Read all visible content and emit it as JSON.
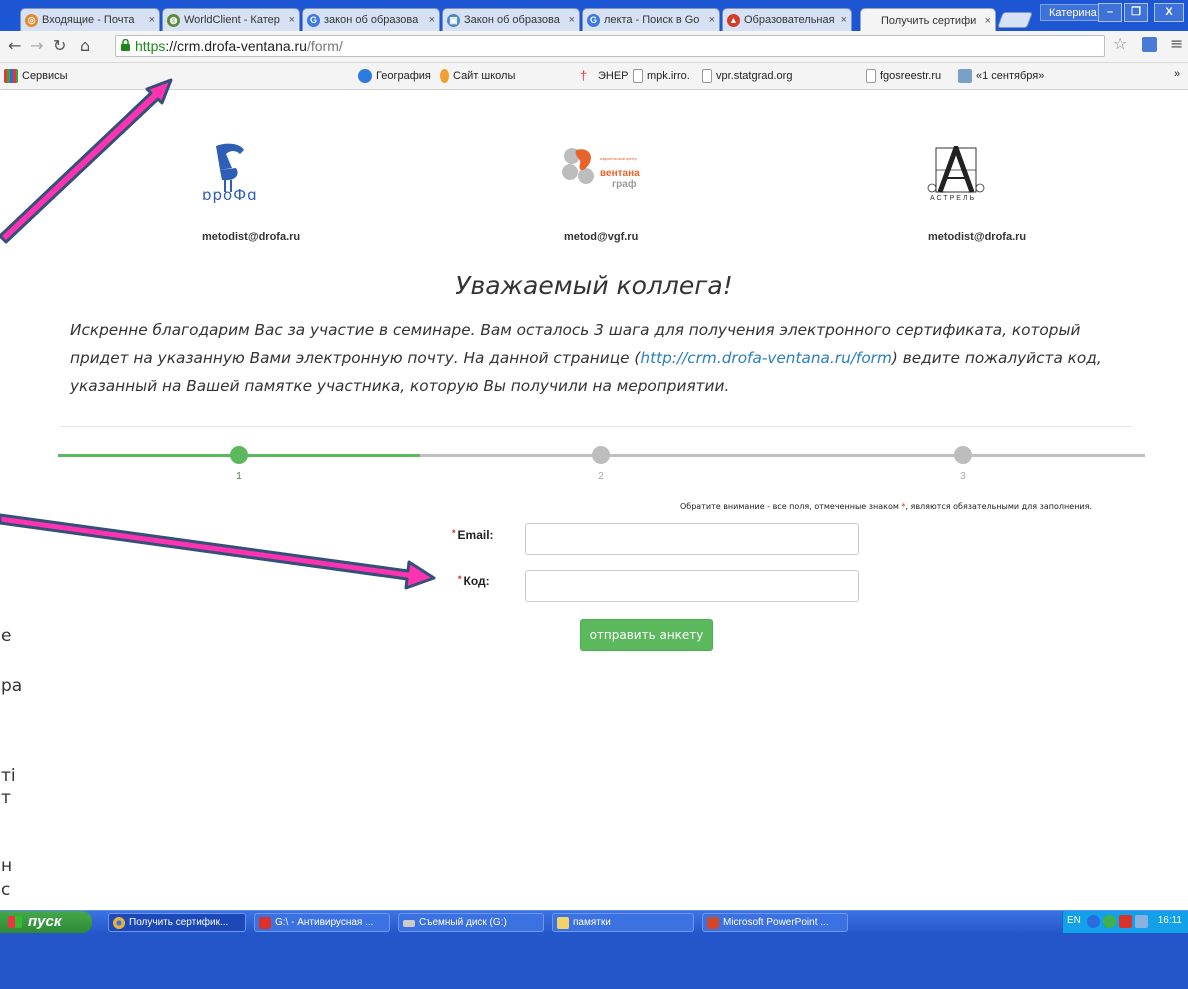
{
  "colors": {
    "accent_green": "#5cb85c",
    "step_active": "#5cb85c",
    "step_inactive": "#c0c0c0",
    "link_blue": "#2a7fc0",
    "required_red": "#d22222",
    "arrow_pink": "#ff33b0",
    "arrow_outline": "#34507a",
    "xp_taskbar": "#2456c9",
    "tab_strip": "#1c56d2"
  },
  "browser": {
    "tabs": [
      {
        "title": "Входящие - Почта",
        "icon": "mail-icon"
      },
      {
        "title": "WorldClient - Катер",
        "icon": "globe-icon"
      },
      {
        "title": "закон об образова",
        "icon": "google-icon"
      },
      {
        "title": "Закон об образова",
        "icon": "book-icon"
      },
      {
        "title": "лекта - Поиск в Go",
        "icon": "google-icon"
      },
      {
        "title": "Образовательная",
        "icon": "app-icon"
      },
      {
        "title": "Получить сертифи",
        "icon": "page-icon",
        "active": true
      }
    ],
    "user": "Катерина",
    "window_buttons": [
      "–",
      "❐",
      "X"
    ],
    "url": {
      "scheme": "https",
      "host": "://crm.drofa-ventana.ru",
      "path": "/form/"
    }
  },
  "bookmarks": {
    "apps_label": "Сервисы",
    "items": [
      "География",
      "Сайт школы",
      "ЭНЕР",
      "mpk.irro.",
      "vpr.statgrad.org",
      "fgosreestr.ru",
      "«1 сентября»"
    ],
    "overflow": "»"
  },
  "page": {
    "logos": [
      {
        "name": "Дрофа",
        "text": "ɒроФɑ",
        "email": "metodist@drofa.ru"
      },
      {
        "name": "Вентана-Граф",
        "small": "издательский центр",
        "line1": "вентана",
        "line2": "граф",
        "email": "metod@vgf.ru"
      },
      {
        "name": "Астрель",
        "text": "АСТРЕЛЬ",
        "email": "metodist@drofa.ru"
      }
    ],
    "heading": "Уважаемый коллега!",
    "intro_before": "Искренне благодарим Вас за участие в семинаре. Вам осталось 3 шага для получения электронного сертификата, который придет на указанную Вами электронную почту. На данной странице (",
    "intro_link": "http://crm.drofa-ventana.ru/form",
    "intro_after": ") ведите пожалуйста код, указанный на Вашей памятке участника, которую Вы получили на мероприятии.",
    "steps": {
      "labels": [
        "1",
        "2",
        "3"
      ],
      "current": 1
    },
    "notice_before": "Обратите внимание - все поля, отмеченные знаком ",
    "notice_star": "*",
    "notice_after": ", являются обязательными для заполнения.",
    "form": {
      "email_label": "Email:",
      "code_label": "Код:",
      "required_mark": "*",
      "email_value": "",
      "code_value": "",
      "submit_label": "отправить анкету"
    },
    "left_fragments": [
      "е",
      "ра",
      "ті",
      "т",
      "н",
      "с"
    ]
  },
  "taskbar": {
    "start_label": "пуск",
    "items": [
      {
        "label": "Получить сертифик...",
        "icon": "chrome-icon"
      },
      {
        "label": "G:\\ - Антивирусная ...",
        "icon": "antivirus-icon"
      },
      {
        "label": "Съемный диск (G:)",
        "icon": "drive-icon"
      },
      {
        "label": "памятки",
        "icon": "folder-icon"
      },
      {
        "label": "Microsoft PowerPoint ...",
        "icon": "powerpoint-icon"
      }
    ],
    "lang": "EN",
    "clock": "16:11"
  }
}
